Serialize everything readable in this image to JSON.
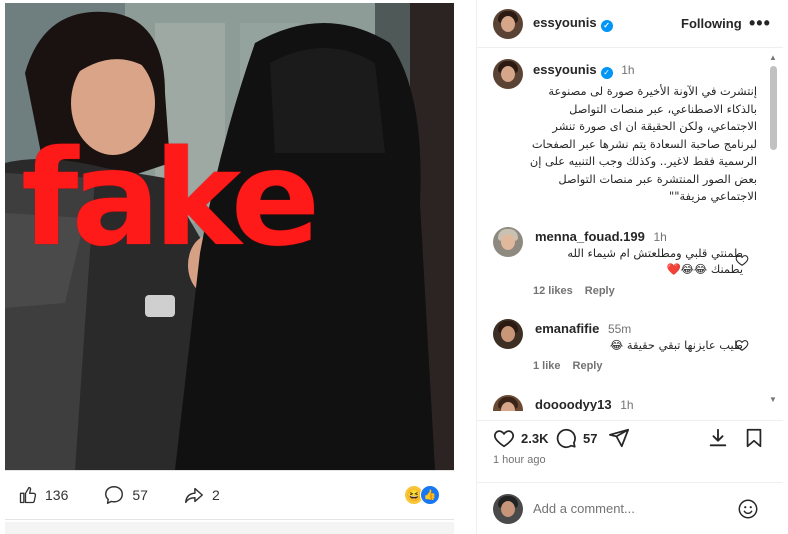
{
  "post": {
    "overlay_text": "fake",
    "reactions": {
      "like_count": "136",
      "comment_count": "57",
      "share_count": "2"
    }
  },
  "header": {
    "username": "essyounis",
    "following_label": "Following",
    "more_label": "•••"
  },
  "caption": {
    "username": "essyounis",
    "time": "1h",
    "text": "إنتشرت في الآونة الأخيرة صورة لى مصنوعة بالذكاء الاصطناعي، عبر منصات التواصل الاجتماعي، ولكن الحقيقة ان اى صورة تنشر لبرنامج صاحبة السعادة يتم نشرها عبر الصفحات الرسمية فقط لاغير.. وكذلك وجب التنبيه على إن بعض الصور المنتشرة عبر منصات التواصل الاجتماعي مزيفة\"\""
  },
  "comments": [
    {
      "username": "menna_fouad.199",
      "time": "1h",
      "text": "طمنتي قلبي ومطلعتش ام شيماء الله يطمنك 😂😂❤️",
      "likes": "12 likes",
      "reply": "Reply"
    },
    {
      "username": "emanafifie",
      "time": "55m",
      "text": "طيب عايزنها تبقي حقيقة 😂",
      "likes": "1 like",
      "reply": "Reply"
    },
    {
      "username": "doooodyy13",
      "time": "1h"
    }
  ],
  "actions": {
    "likes": "2.3K",
    "comments": "57",
    "ago": "1 hour ago"
  },
  "add_comment": {
    "placeholder": "Add a comment..."
  },
  "icons": {
    "fb_like": "thumbs-up-icon",
    "fb_comment": "speech-bubble-icon",
    "fb_share": "share-arrow-icon",
    "heart": "heart-icon",
    "comment": "comment-icon",
    "share": "paper-plane-icon",
    "save": "bookmark-icon",
    "download": "download-icon",
    "emoji": "smiley-icon"
  },
  "colors": {
    "fake_red": "#ff1a1a",
    "verified_blue": "#0095f6",
    "muted": "#737373"
  }
}
